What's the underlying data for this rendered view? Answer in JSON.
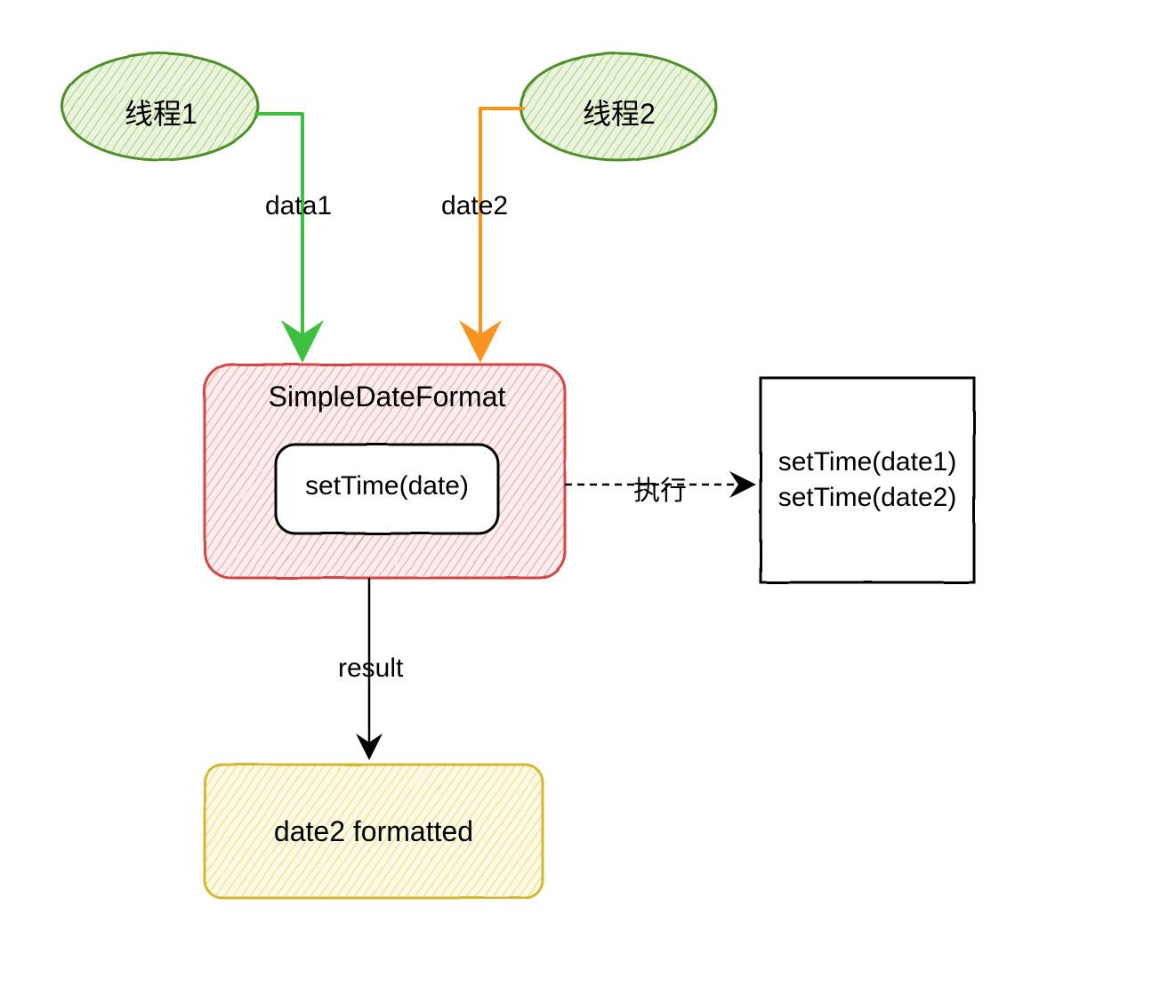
{
  "nodes": {
    "thread1": "线程1",
    "thread2": "线程2",
    "sdf_title": "SimpleDateFormat",
    "sdf_method": "setTime(date)",
    "exec_line1": "setTime(date1)",
    "exec_line2": "setTime(date2)",
    "result_box": "date2 formatted"
  },
  "edges": {
    "data1": "data1",
    "date2": "date2",
    "execute": "执行",
    "result": "result"
  },
  "colors": {
    "green_fill": "#c9dfb4",
    "green_stroke": "#4f8f2a",
    "green_arrow": "#3fbf3f",
    "orange_arrow": "#f7931e",
    "red_fill": "#f8d7d7",
    "red_stroke": "#d64545",
    "yellow_fill": "#faf0c8",
    "yellow_stroke": "#d4b830"
  }
}
